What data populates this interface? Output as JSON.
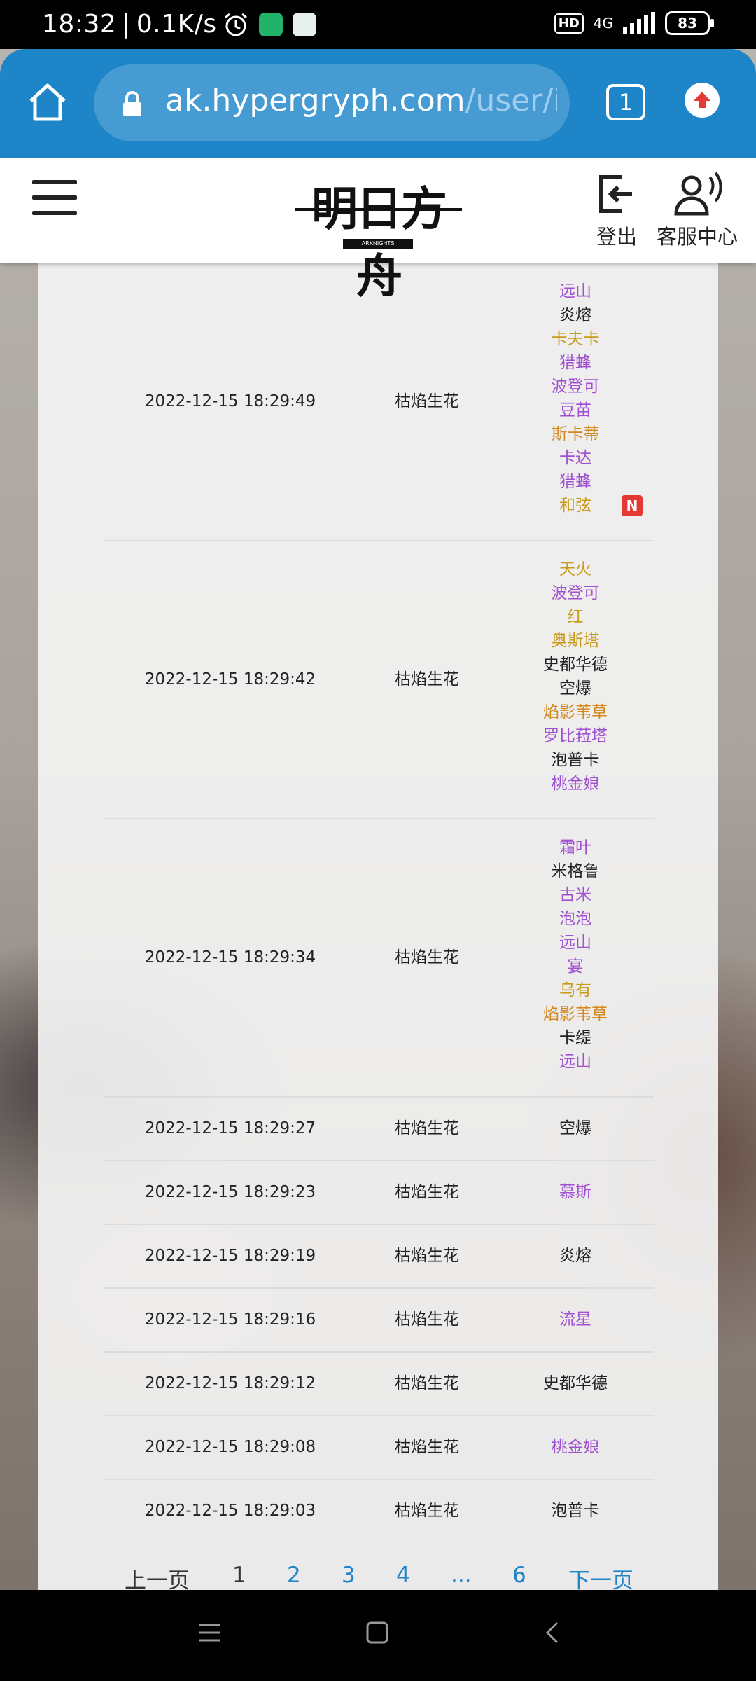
{
  "status_bar": {
    "time": "18:32",
    "net_speed": "0.1K/s",
    "network": "4G",
    "hd": "HD",
    "battery": "83",
    "colors": {
      "bg": "#000000",
      "text": "#ffffff"
    }
  },
  "browser": {
    "url_host": "ak.hypergryph.com",
    "url_path": "/user/ir",
    "tab_count": "1",
    "accent": "#1e86c8"
  },
  "header": {
    "logo_text": "明日方舟",
    "logo_sub": "ARKNIGHTS",
    "logout_label": "登出",
    "service_label": "客服中心"
  },
  "rarity_colors": {
    "6": "#d4891f",
    "5": "#c99a1a",
    "4": "#a050d0",
    "3": "#222222"
  },
  "records": [
    {
      "time": "2022-12-15 18:29:49",
      "pool": "枯焰生花",
      "ops": [
        {
          "name": "远山",
          "rarity": 4
        },
        {
          "name": "炎熔",
          "rarity": 3
        },
        {
          "name": "卡夫卡",
          "rarity": 5
        },
        {
          "name": "猎蜂",
          "rarity": 4
        },
        {
          "name": "波登可",
          "rarity": 4
        },
        {
          "name": "豆苗",
          "rarity": 4
        },
        {
          "name": "斯卡蒂",
          "rarity": 6
        },
        {
          "name": "卡达",
          "rarity": 4
        },
        {
          "name": "猎蜂",
          "rarity": 4
        },
        {
          "name": "和弦",
          "rarity": 5,
          "new": "N"
        }
      ]
    },
    {
      "time": "2022-12-15 18:29:42",
      "pool": "枯焰生花",
      "ops": [
        {
          "name": "天火",
          "rarity": 5
        },
        {
          "name": "波登可",
          "rarity": 4
        },
        {
          "name": "红",
          "rarity": 5
        },
        {
          "name": "奥斯塔",
          "rarity": 5
        },
        {
          "name": "史都华德",
          "rarity": 3
        },
        {
          "name": "空爆",
          "rarity": 3
        },
        {
          "name": "焰影苇草",
          "rarity": 6
        },
        {
          "name": "罗比菈塔",
          "rarity": 4
        },
        {
          "name": "泡普卡",
          "rarity": 3
        },
        {
          "name": "桃金娘",
          "rarity": 4
        }
      ]
    },
    {
      "time": "2022-12-15 18:29:34",
      "pool": "枯焰生花",
      "ops": [
        {
          "name": "霜叶",
          "rarity": 4
        },
        {
          "name": "米格鲁",
          "rarity": 3
        },
        {
          "name": "古米",
          "rarity": 4
        },
        {
          "name": "泡泡",
          "rarity": 4
        },
        {
          "name": "远山",
          "rarity": 4
        },
        {
          "name": "宴",
          "rarity": 4
        },
        {
          "name": "乌有",
          "rarity": 5
        },
        {
          "name": "焰影苇草",
          "rarity": 6
        },
        {
          "name": "卡缇",
          "rarity": 3
        },
        {
          "name": "远山",
          "rarity": 4
        }
      ]
    },
    {
      "time": "2022-12-15 18:29:27",
      "pool": "枯焰生花",
      "ops": [
        {
          "name": "空爆",
          "rarity": 3
        }
      ]
    },
    {
      "time": "2022-12-15 18:29:23",
      "pool": "枯焰生花",
      "ops": [
        {
          "name": "慕斯",
          "rarity": 4
        }
      ]
    },
    {
      "time": "2022-12-15 18:29:19",
      "pool": "枯焰生花",
      "ops": [
        {
          "name": "炎熔",
          "rarity": 3
        }
      ]
    },
    {
      "time": "2022-12-15 18:29:16",
      "pool": "枯焰生花",
      "ops": [
        {
          "name": "流星",
          "rarity": 4
        }
      ]
    },
    {
      "time": "2022-12-15 18:29:12",
      "pool": "枯焰生花",
      "ops": [
        {
          "name": "史都华德",
          "rarity": 3
        }
      ]
    },
    {
      "time": "2022-12-15 18:29:08",
      "pool": "枯焰生花",
      "ops": [
        {
          "name": "桃金娘",
          "rarity": 4
        }
      ]
    },
    {
      "time": "2022-12-15 18:29:03",
      "pool": "枯焰生花",
      "ops": [
        {
          "name": "泡普卡",
          "rarity": 3
        }
      ]
    }
  ],
  "pagination": {
    "prev": "上一页",
    "pages": [
      "1",
      "2",
      "3",
      "4",
      "...",
      "6"
    ],
    "current": "1",
    "next": "下一页"
  }
}
